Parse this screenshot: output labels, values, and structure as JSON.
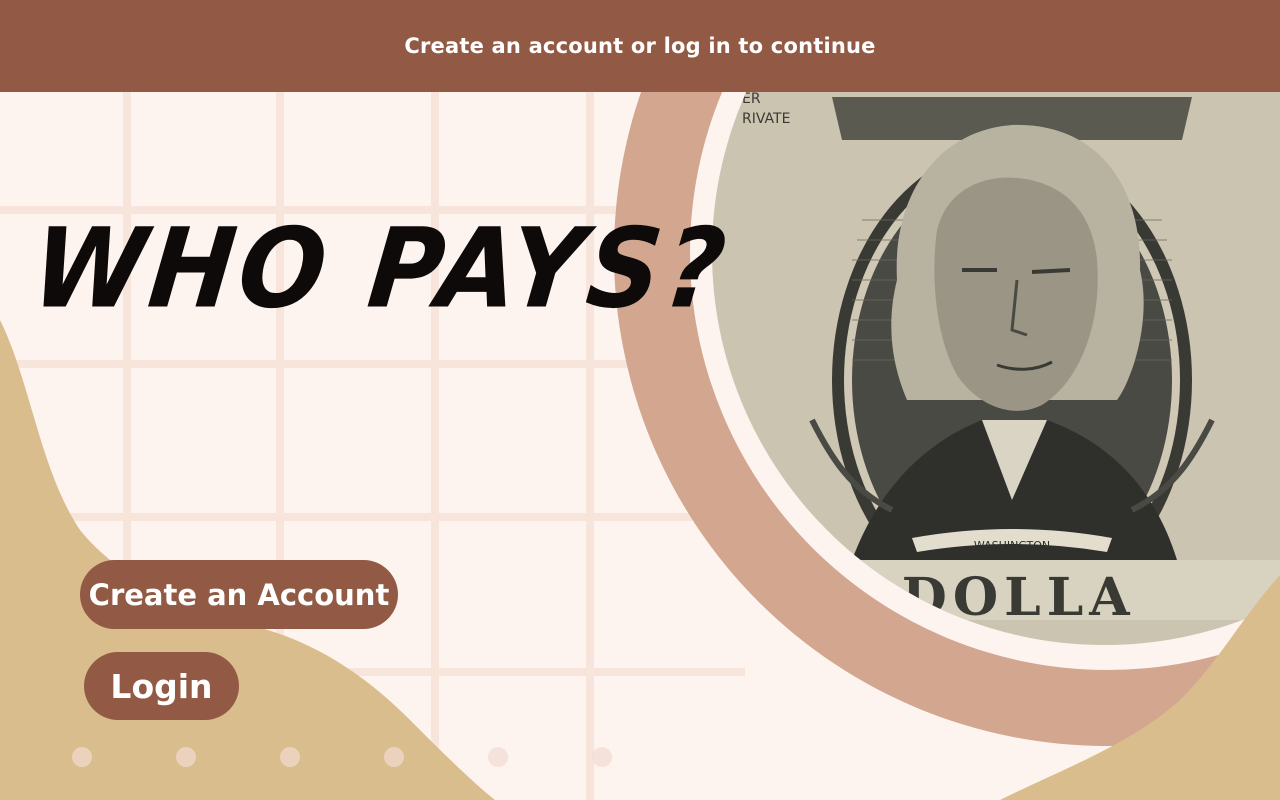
{
  "banner": {
    "text": "Create an account or log in to continue"
  },
  "hero": {
    "headline": "WHO PAYS?",
    "image_icon": "dollar-bill-portrait-image",
    "image_text": {
      "note_word": "E DOLLA",
      "name_scroll": "WASHINGTON",
      "corner_text_1": "ER",
      "corner_text_2": "RIVATE"
    }
  },
  "actions": {
    "create_account_label": "Create an Account",
    "login_label": "Login"
  },
  "colors": {
    "banner": "#925a44",
    "background": "#fdf3ef",
    "grid": "#f7e5dc",
    "ring": "#d2a68f",
    "blob": "#d9bd8d",
    "button": "#925a44",
    "headline": "#0d0a09"
  }
}
